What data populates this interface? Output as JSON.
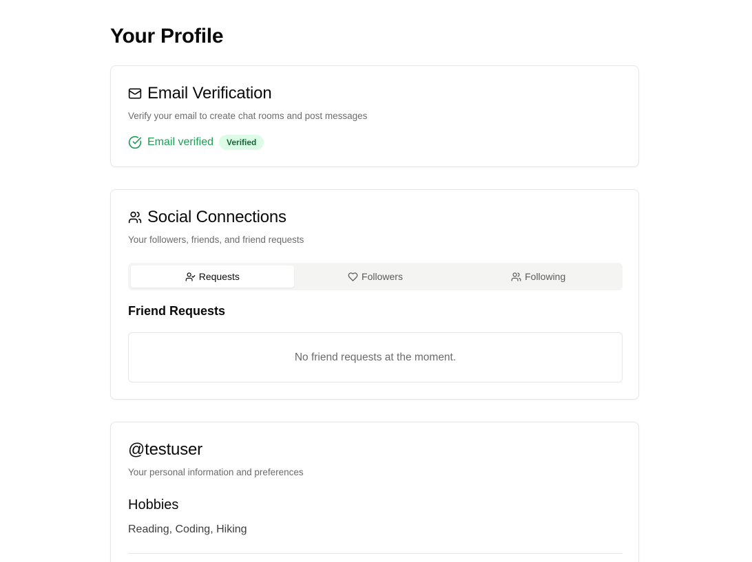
{
  "page": {
    "title": "Your Profile"
  },
  "email_card": {
    "icon": "mail-icon",
    "title": "Email Verification",
    "description": "Verify your email to create chat rooms and post messages",
    "status_icon": "check-circle-icon",
    "status_text": "Email verified",
    "badge": "Verified",
    "status_color": "#1f9d55"
  },
  "social_card": {
    "icon": "users-icon",
    "title": "Social Connections",
    "description": "Your followers, friends, and friend requests",
    "tabs": [
      {
        "label": "Requests",
        "icon": "user-check-icon",
        "active": true
      },
      {
        "label": "Followers",
        "icon": "heart-icon",
        "active": false
      },
      {
        "label": "Following",
        "icon": "users-icon",
        "active": false
      }
    ],
    "section_title": "Friend Requests",
    "empty_message": "No friend requests at the moment."
  },
  "profile_card": {
    "title": "@testuser",
    "description": "Your personal information and preferences",
    "hobbies_title": "Hobbies",
    "hobbies_value": "Reading, Coding, Hiking"
  }
}
